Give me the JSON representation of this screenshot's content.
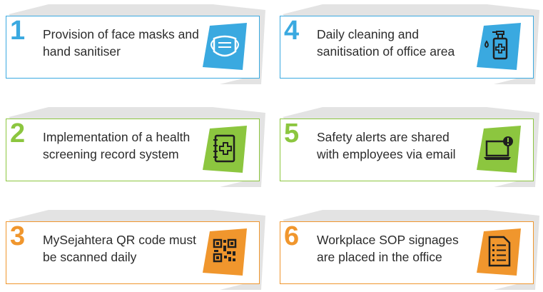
{
  "items": [
    {
      "number": "1",
      "text": "Provision of face masks and hand sanitiser",
      "icon": "face-mask-icon",
      "color": "#3aa9e0"
    },
    {
      "number": "2",
      "text": "Implementation of a health screening record system",
      "icon": "medical-record-book-icon",
      "color": "#8cc63f"
    },
    {
      "number": "3",
      "text": "MySejahtera QR code must be scanned daily",
      "icon": "qr-code-icon",
      "color": "#f0962d"
    },
    {
      "number": "4",
      "text": "Daily cleaning and sanitisation of office area",
      "icon": "sanitiser-bottle-icon",
      "color": "#3aa9e0"
    },
    {
      "number": "5",
      "text": "Safety alerts are shared with employees via email",
      "icon": "laptop-alert-icon",
      "color": "#8cc63f"
    },
    {
      "number": "6",
      "text": "Workplace SOP signages are placed in the office",
      "icon": "checklist-document-icon",
      "color": "#f0962d"
    }
  ]
}
